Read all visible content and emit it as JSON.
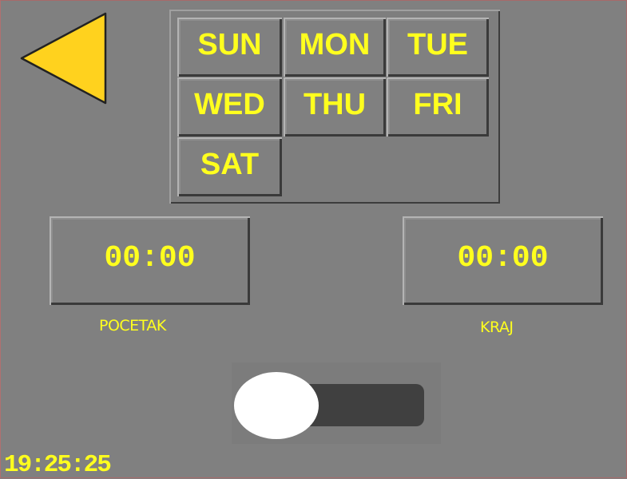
{
  "back": {
    "icon": "back-arrow-icon",
    "color": "#ffd21e"
  },
  "days": [
    {
      "label": "SUN"
    },
    {
      "label": "MON"
    },
    {
      "label": "TUE"
    },
    {
      "label": "WED"
    },
    {
      "label": "THU"
    },
    {
      "label": "FRI"
    },
    {
      "label": "SAT"
    }
  ],
  "start": {
    "time": "00:00",
    "label": "POCETAK"
  },
  "end": {
    "time": "00:00",
    "label": "KRAJ"
  },
  "toggle": {
    "state": "off"
  },
  "clock": "19:25:25",
  "colors": {
    "background": "#808080",
    "text": "#ffff1e",
    "arrow": "#ffd21e",
    "toggle_track": "#404040",
    "toggle_knob": "#ffffff"
  }
}
